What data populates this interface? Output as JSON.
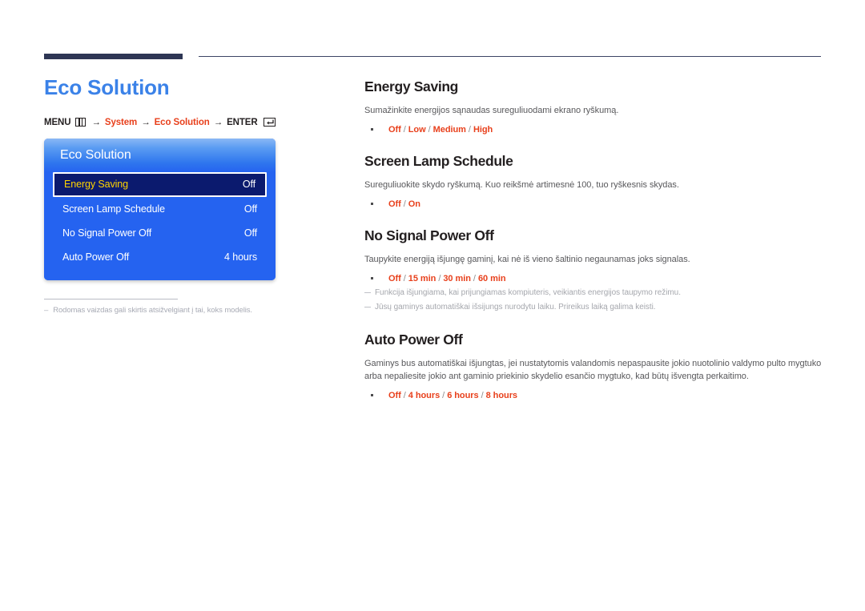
{
  "header": {
    "rule_color": "#2e3654"
  },
  "left": {
    "page_title": "Eco Solution",
    "menu_path": {
      "menu_label": "MENU",
      "menu_icon": "menu-grid-icon",
      "arrow1": "→",
      "step1": "System",
      "arrow2": "→",
      "step2": "Eco Solution",
      "arrow3": "→",
      "enter_label": "ENTER",
      "enter_icon": "enter-return-icon"
    },
    "osd": {
      "title": "Eco Solution",
      "accent_color": "#2563f0",
      "selected_bg": "#0b1a6e",
      "selected_text_color": "#ffd400",
      "rows": [
        {
          "label": "Energy Saving",
          "value": "Off",
          "selected": true
        },
        {
          "label": "Screen Lamp Schedule",
          "value": "Off",
          "selected": false
        },
        {
          "label": "No Signal Power Off",
          "value": "Off",
          "selected": false
        },
        {
          "label": "Auto Power Off",
          "value": "4 hours",
          "selected": false
        }
      ]
    },
    "footnote": {
      "dash": "–",
      "text": "Rodomas vaizdas gali skirtis atsižvelgiant į tai, koks modelis."
    }
  },
  "right": {
    "sections": [
      {
        "title": "Energy Saving",
        "description": "Sumažinkite energijos sąnaudas sureguliuodami ekrano ryškumą.",
        "options": [
          "Off",
          "Low",
          "Medium",
          "High"
        ],
        "notes": []
      },
      {
        "title": "Screen Lamp Schedule",
        "description": "Sureguliuokite skydo ryškumą. Kuo reikšmė artimesnė 100, tuo ryškesnis skydas.",
        "options": [
          "Off",
          "On"
        ],
        "notes": []
      },
      {
        "title": "No Signal Power Off",
        "description": "Taupykite energiją išjungę gaminį, kai nė iš vieno šaltinio negaunamas joks signalas.",
        "options": [
          "Off",
          "15 min",
          "30 min",
          "60 min"
        ],
        "notes": [
          "Funkcija išjungiama, kai prijungiamas kompiuteris, veikiantis energijos taupymo režimu.",
          "Jūsų gaminys automatiškai išsijungs nurodytu laiku. Prireikus laiką galima keisti."
        ]
      },
      {
        "title": "Auto Power Off",
        "description": "Gaminys bus automatiškai išjungtas, jei nustatytomis valandomis nepaspausite jokio nuotolinio valdymo pulto mygtuko arba nepaliesite jokio ant gaminio priekinio skydelio esančio mygtuko, kad būtų išvengta perkaitimo.",
        "options": [
          "Off",
          "4 hours",
          "6 hours",
          "8 hours"
        ],
        "notes": []
      }
    ],
    "option_separator": " / ",
    "option_color": "#e8401c"
  }
}
